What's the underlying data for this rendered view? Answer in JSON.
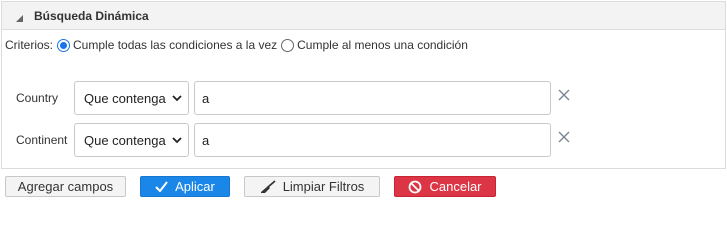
{
  "panel": {
    "title": "Búsqueda Dinámica",
    "collapse_icon": "triangle-collapse-icon"
  },
  "criteria": {
    "label": "Criterios:",
    "options": [
      {
        "label": "Cumple todas las condiciones a la vez",
        "selected": true
      },
      {
        "label": "Cumple al menos una condición",
        "selected": false
      }
    ]
  },
  "filters": [
    {
      "field": "Country",
      "operator": "Que contenga",
      "value": "a"
    },
    {
      "field": "Continent",
      "operator": "Que contenga",
      "value": "a"
    }
  ],
  "buttons": {
    "add": "Agregar campos",
    "apply": "Aplicar",
    "clear": "Limpiar Filtros",
    "cancel": "Cancelar"
  },
  "colors": {
    "accent": "#1a86e8",
    "danger": "#dc3545"
  }
}
